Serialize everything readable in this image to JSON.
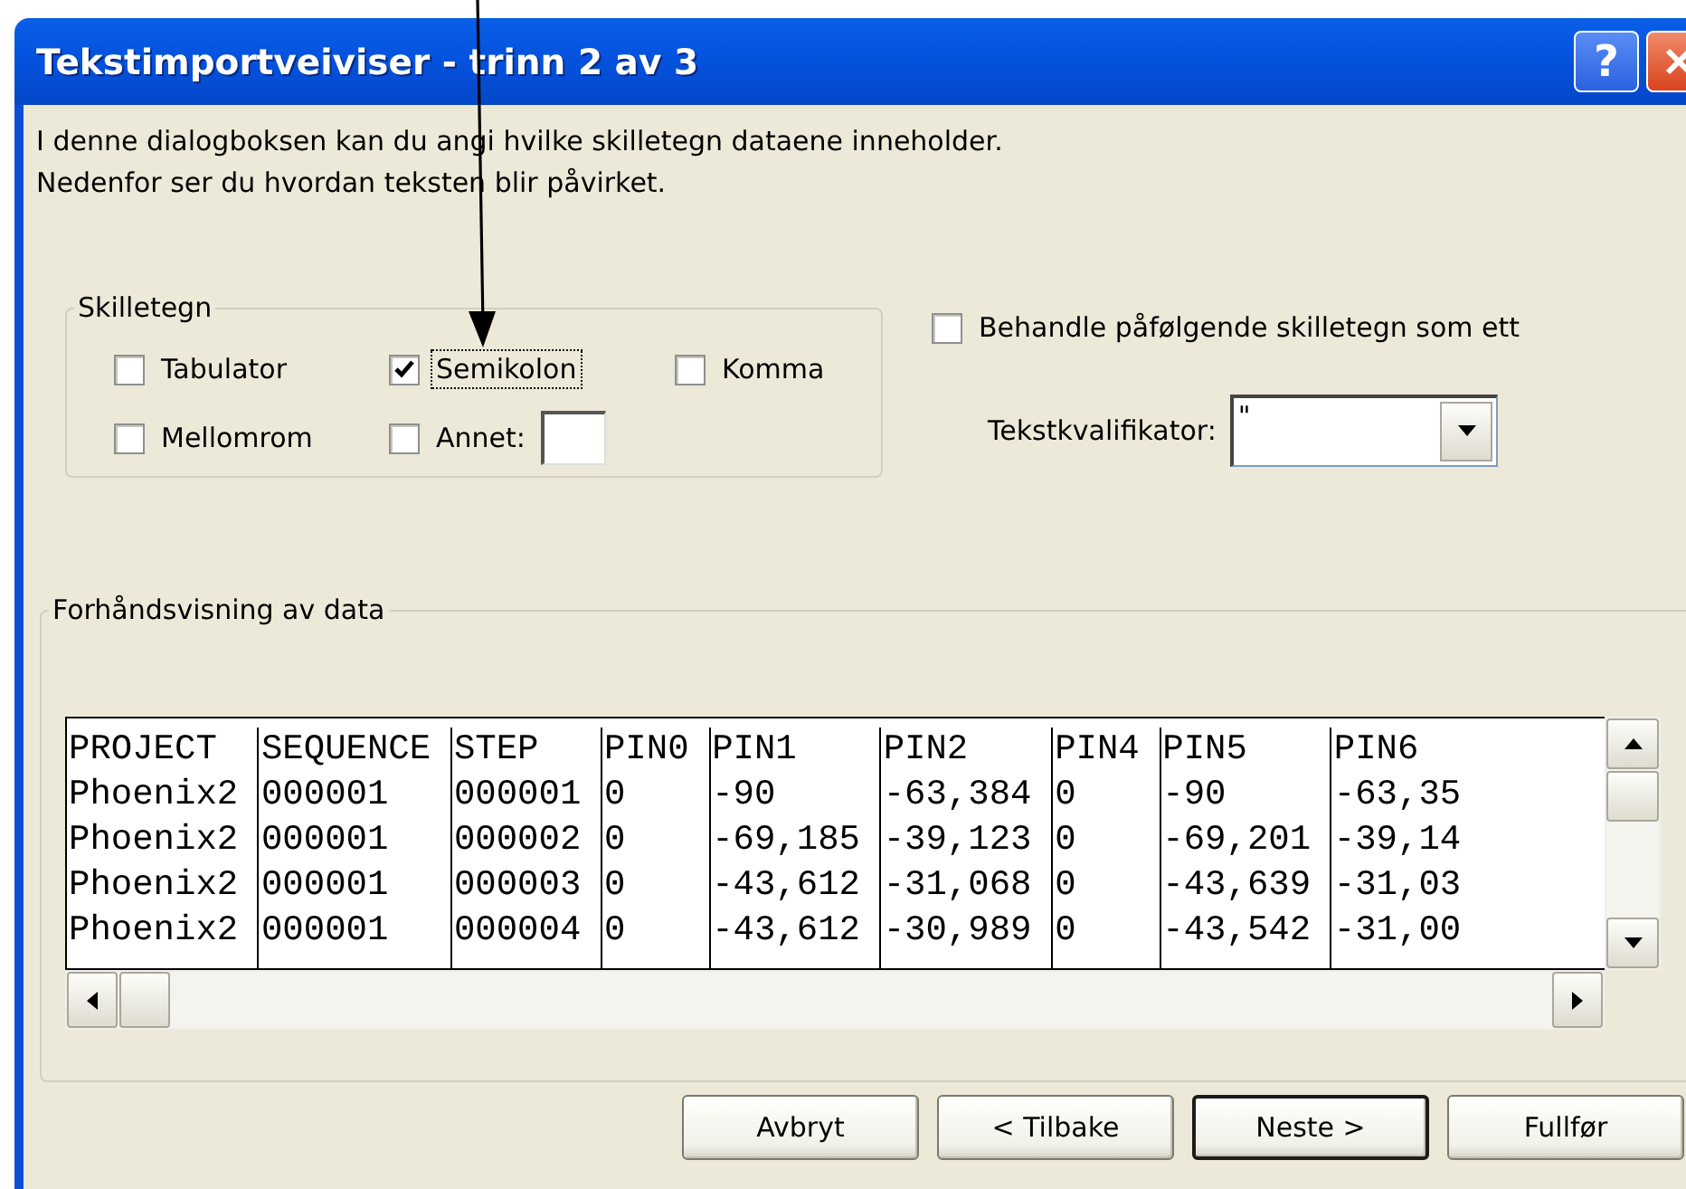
{
  "window": {
    "title": "Tekstimportveiviser - trinn 2 av 3",
    "help_button": "?"
  },
  "intro": [
    "I denne dialogboksen kan du angi hvilke skilletegn dataene inneholder.",
    "Nedenfor ser du hvordan teksten blir påvirket."
  ],
  "delimiters": {
    "title": "Skilletegn",
    "options": [
      {
        "label": "Tabulator",
        "checked": false,
        "focused": false
      },
      {
        "label": "Semikolon",
        "checked": true,
        "focused": true
      },
      {
        "label": "Komma",
        "checked": false,
        "focused": false
      },
      {
        "label": "Mellomrom",
        "checked": false,
        "focused": false
      },
      {
        "label": "Annet:",
        "checked": false,
        "focused": false,
        "kind": "with_field"
      }
    ]
  },
  "consecutive": {
    "label": "Behandle påfølgende skilletegn som ett",
    "checked": false
  },
  "text_qualifier": {
    "label": "Tekstkvalifikator:",
    "value": "\""
  },
  "preview": {
    "title": "Forhåndsvisning av data",
    "rows": [
      [
        "PROJECT",
        "SEQUENCE",
        "STEP",
        "PIN0",
        "PIN1",
        "PIN2",
        "PIN4",
        "PIN5",
        "PIN6"
      ],
      [
        "Phoenix2",
        "000001",
        "000001",
        "0",
        "-90",
        "-63,384",
        "0",
        "-90",
        "-63,35"
      ],
      [
        "Phoenix2",
        "000001",
        "000002",
        "0",
        "-69,185",
        "-39,123",
        "0",
        "-69,201",
        "-39,14"
      ],
      [
        "Phoenix2",
        "000001",
        "000003",
        "0",
        "-43,612",
        "-31,068",
        "0",
        "-43,639",
        "-31,03"
      ],
      [
        "Phoenix2",
        "000001",
        "000004",
        "0",
        "-43,612",
        "-30,989",
        "0",
        "-43,542",
        "-31,00"
      ]
    ]
  },
  "buttons": [
    {
      "label": "Avbryt",
      "default": false
    },
    {
      "label": "< Tilbake",
      "default": false
    },
    {
      "label": "Neste >",
      "default": true
    },
    {
      "label": "Fullfør",
      "default": false
    }
  ]
}
